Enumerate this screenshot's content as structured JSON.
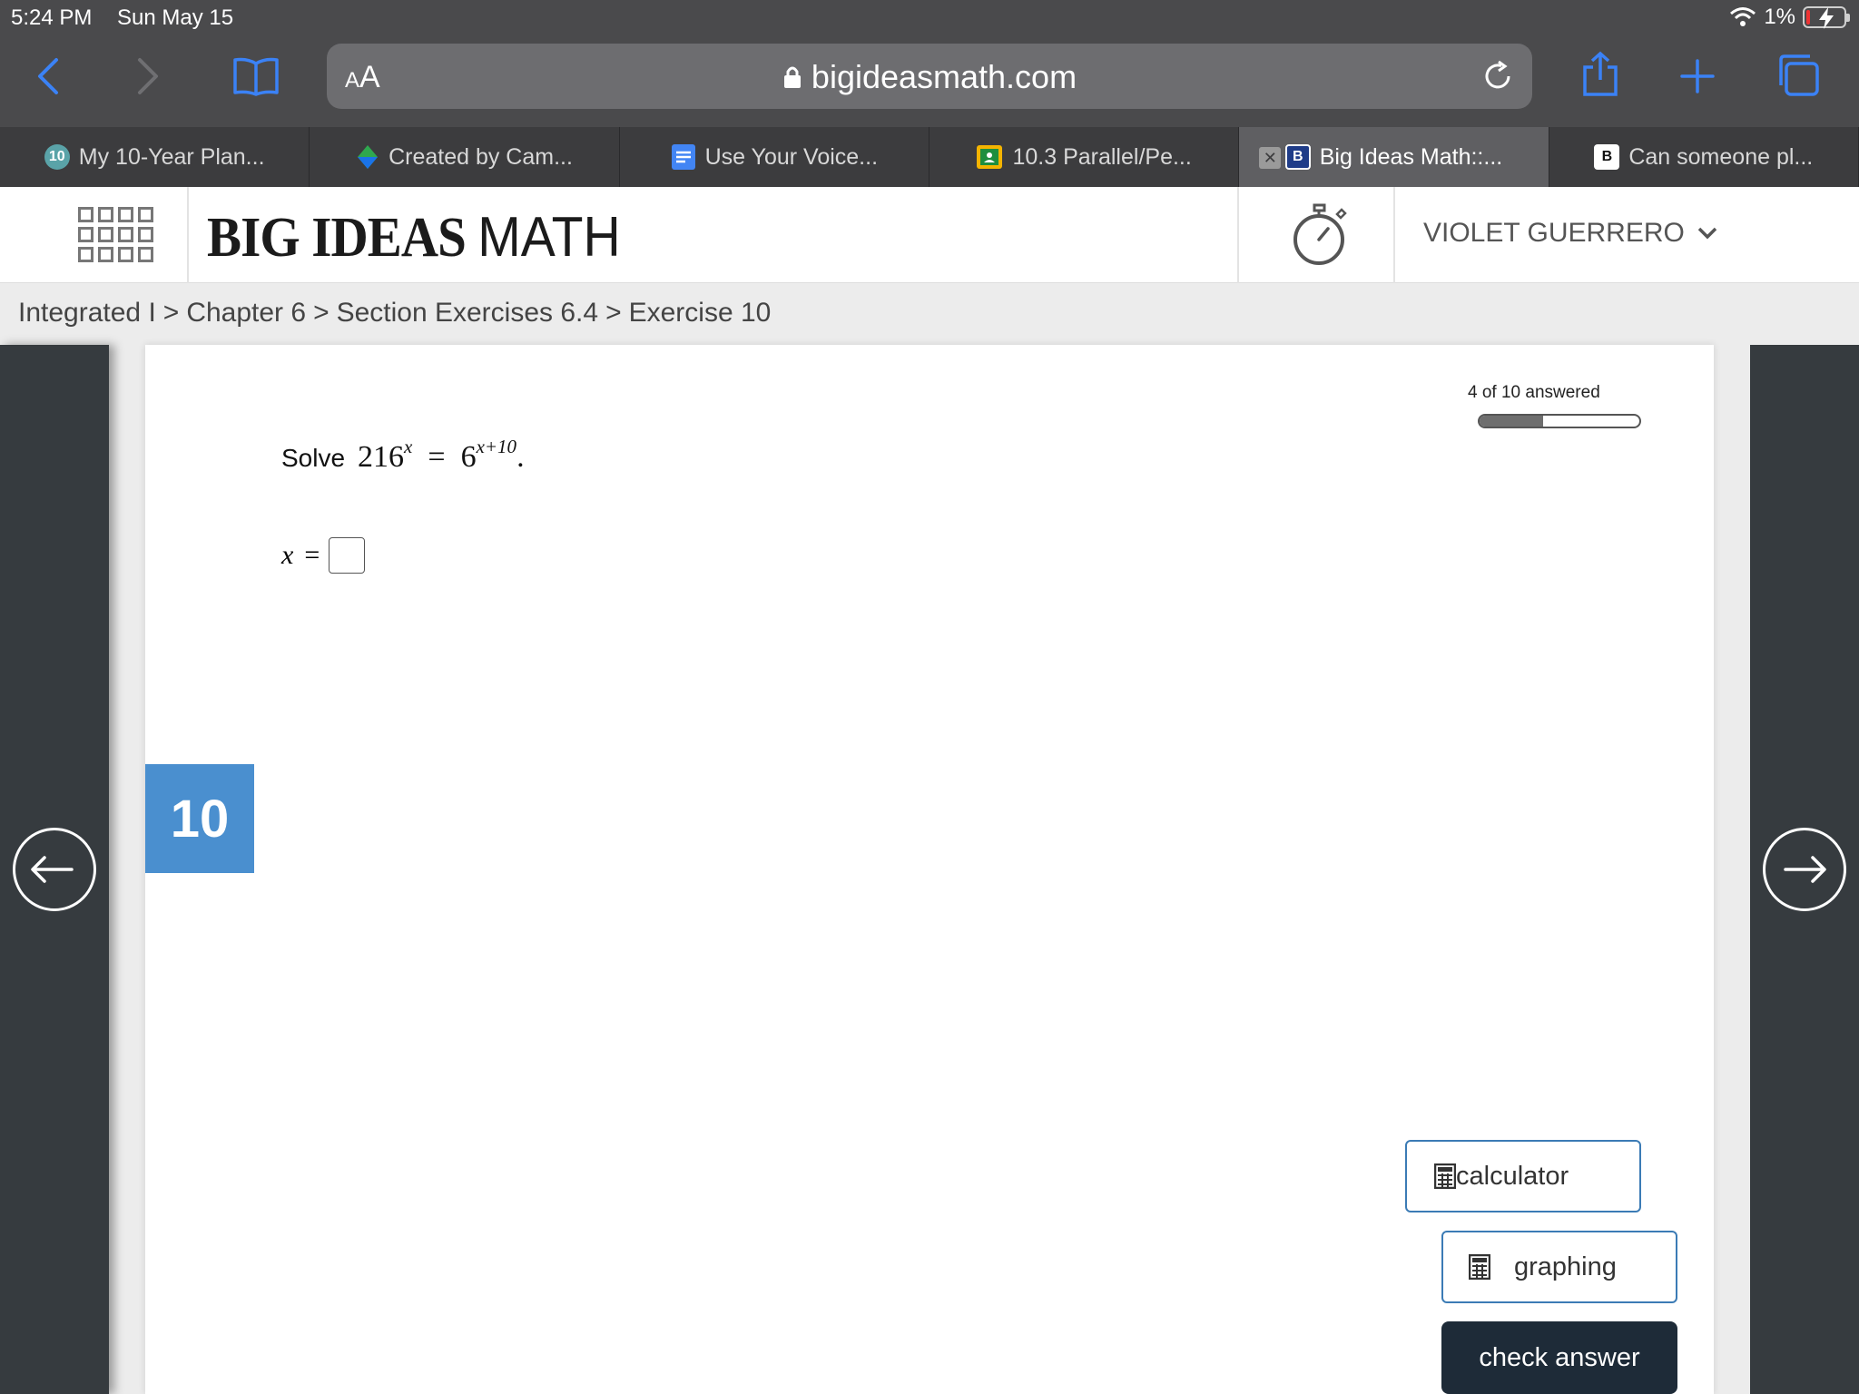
{
  "status_bar": {
    "time": "5:24 PM",
    "date": "Sun May 15",
    "battery": "1%"
  },
  "browser": {
    "url": "bigideasmath.com",
    "text_size_label_small": "A",
    "text_size_label_large": "A",
    "tabs": [
      {
        "label": "My 10-Year Plan...",
        "favicon": "10"
      },
      {
        "label": "Created by Cam...",
        "favicon": ""
      },
      {
        "label": "Use Your Voice...",
        "favicon": ""
      },
      {
        "label": "10.3 Parallel/Pe...",
        "favicon": ""
      },
      {
        "label": "Big Ideas Math::...",
        "favicon": "B",
        "active": true
      },
      {
        "label": "Can someone pl...",
        "favicon": "B"
      }
    ],
    "colors": {
      "chrome": "#4a4a4c",
      "accent": "#3478f6"
    }
  },
  "site": {
    "brand_bold": "BIG IDEAS",
    "brand_light": "MATH",
    "user_name": "VIOLET GUERRERO"
  },
  "breadcrumb": [
    "Integrated I",
    "Chapter 6",
    "Section Exercises 6.4",
    "Exercise 10"
  ],
  "breadcrumb_separator": ">",
  "question": {
    "number": "10",
    "progress_label": "4 of 10 answered",
    "progress_answered": 4,
    "progress_total": 10,
    "prompt": "Solve",
    "equation": {
      "base_left": "216",
      "exp_left": "x",
      "equals": "=",
      "base_right": "6",
      "exp_right": "x+10",
      "end": "."
    },
    "answer_var": "x",
    "answer_equals": "=",
    "answer_value": ""
  },
  "tools": {
    "calculator_label": "calculator",
    "graphing_label": "graphing",
    "check_label": "check answer"
  }
}
